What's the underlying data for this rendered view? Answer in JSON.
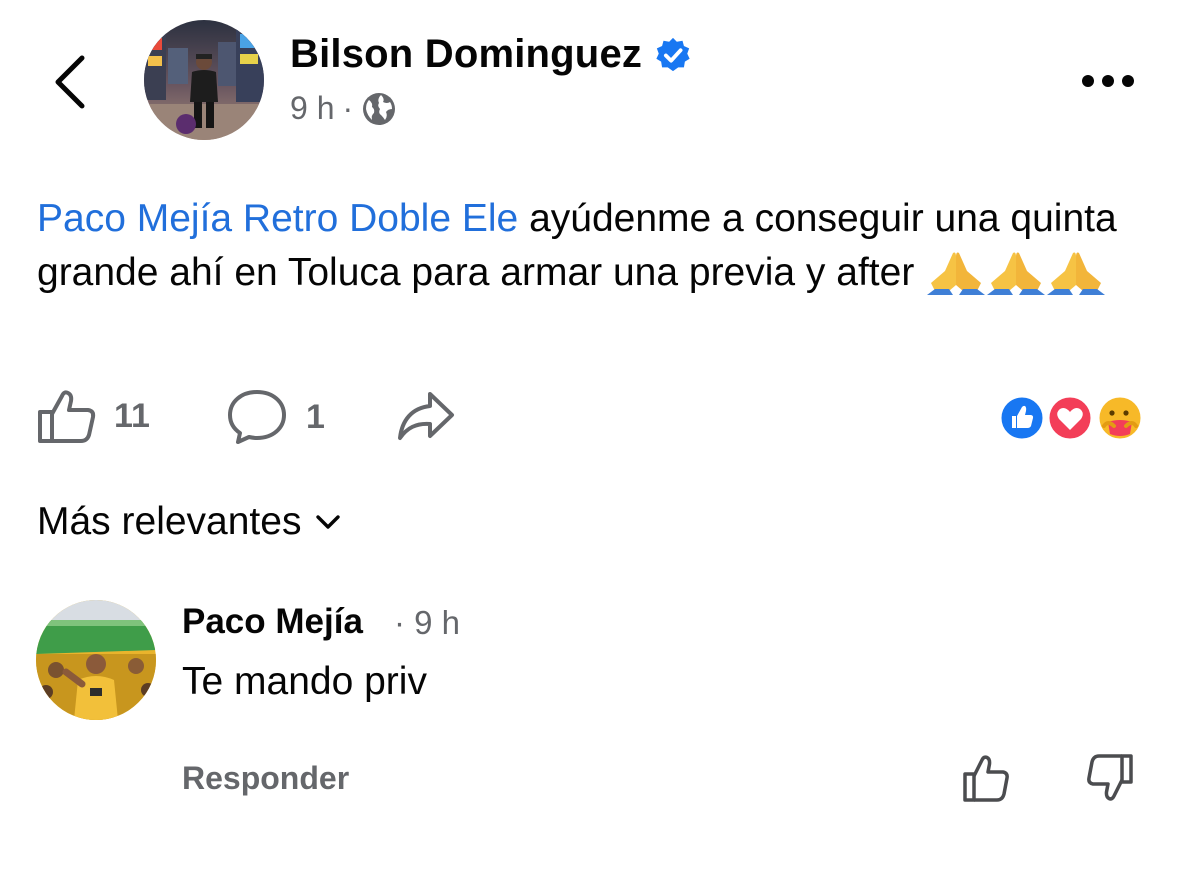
{
  "post": {
    "author": "Bilson Dominguez",
    "time": "9 h",
    "separator": "·",
    "mention": "Paco Mejía Retro Doble Ele",
    "text": " ayúdenme a conseguir una quinta grande ahí en Toluca para armar una previa y after ",
    "emojis": [
      "praying-hands",
      "praying-hands",
      "praying-hands"
    ],
    "likes": "11",
    "comments": "1",
    "reactions": [
      "like",
      "love",
      "care"
    ]
  },
  "sort": {
    "label": "Más relevantes"
  },
  "comment": {
    "name": "Paco Mejía",
    "time": "· 9 h",
    "text": "Te mando priv",
    "reply": "Responder"
  },
  "colors": {
    "mention": "#216fdb",
    "verified": "#1877f2",
    "secondary": "#65676b",
    "love": "#f33e58"
  }
}
